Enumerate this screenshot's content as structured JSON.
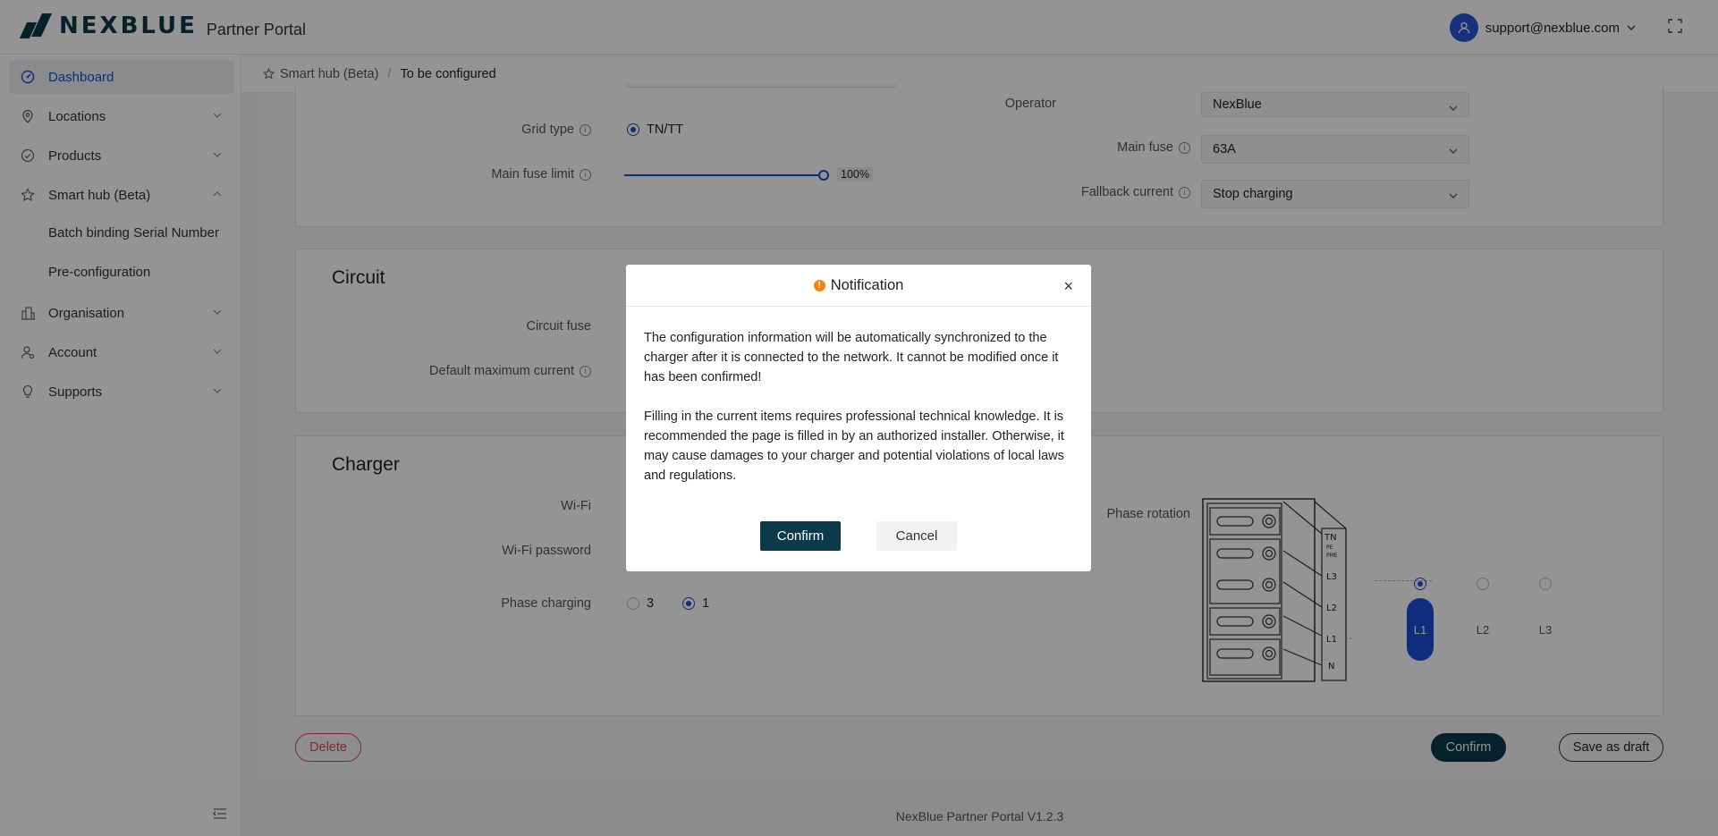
{
  "header": {
    "logo_text": "NEXBLUE",
    "portal_name": "Partner Portal",
    "user_email": "support@nexblue.com"
  },
  "sidebar": {
    "items": [
      {
        "label": "Dashboard",
        "icon": "dashboard-icon"
      },
      {
        "label": "Locations",
        "icon": "location-pin-icon"
      },
      {
        "label": "Products",
        "icon": "products-icon"
      },
      {
        "label": "Smart hub (Beta)",
        "icon": "star-icon"
      },
      {
        "label": "Organisation",
        "icon": "building-icon"
      },
      {
        "label": "Account",
        "icon": "account-icon"
      },
      {
        "label": "Supports",
        "icon": "lightbulb-icon"
      }
    ],
    "sub_items": [
      "Batch binding Serial Number",
      "Pre-configuration"
    ]
  },
  "breadcrumb": {
    "root": "Smart hub (Beta)",
    "separator": "/",
    "current": "To be configured"
  },
  "location_section": {
    "operator_label": "Operator",
    "operator_value": "NexBlue",
    "grid_type_label": "Grid type",
    "grid_type_value": "TN/TT",
    "main_fuse_label": "Main fuse",
    "main_fuse_value": "63A",
    "main_fuse_limit_label": "Main fuse limit",
    "main_fuse_limit_value": "100%",
    "main_fuse_limit_level": 1.0,
    "fallback_label": "Fallback current",
    "fallback_value": "Stop charging"
  },
  "circuit_section": {
    "title": "Circuit",
    "circuit_fuse_label": "Circuit fuse",
    "default_max_label": "Default maximum current"
  },
  "charger_section": {
    "title": "Charger",
    "wifi_label": "Wi-Fi",
    "wifi_password_label": "Wi-Fi password",
    "phase_charging_label": "Phase charging",
    "phase_option_3": "3",
    "phase_option_1": "1",
    "phase_rotation_label": "Phase rotation",
    "terminal_labels": [
      "TN",
      "PE",
      "PME",
      "L3",
      "L2",
      "L1",
      "N"
    ],
    "rotation_options": [
      "L1",
      "L2",
      "L3"
    ],
    "rotation_selected": "L1"
  },
  "actions": {
    "delete": "Delete",
    "confirm": "Confirm",
    "save_draft": "Save as draft"
  },
  "modal": {
    "title": "Notification",
    "paragraph1": "The configuration information will be automatically synchronized to the charger after it is connected to the network. It cannot be modified once it has been confirmed!",
    "paragraph2": "Filling in the current items requires professional technical knowledge. It is recommended the page is filled in by an authorized installer. Otherwise, it may cause damages to your charger and potential violations of local laws and regulations.",
    "confirm": "Confirm",
    "cancel": "Cancel",
    "close": "×",
    "warning_glyph": "!"
  },
  "footer": "NexBlue Partner Portal V1.2.3",
  "colors": {
    "brand_dark": "#0b3a4a",
    "accent_blue": "#1a4fd6",
    "warning_orange": "#f5840c",
    "delete_red": "#e0484e"
  }
}
